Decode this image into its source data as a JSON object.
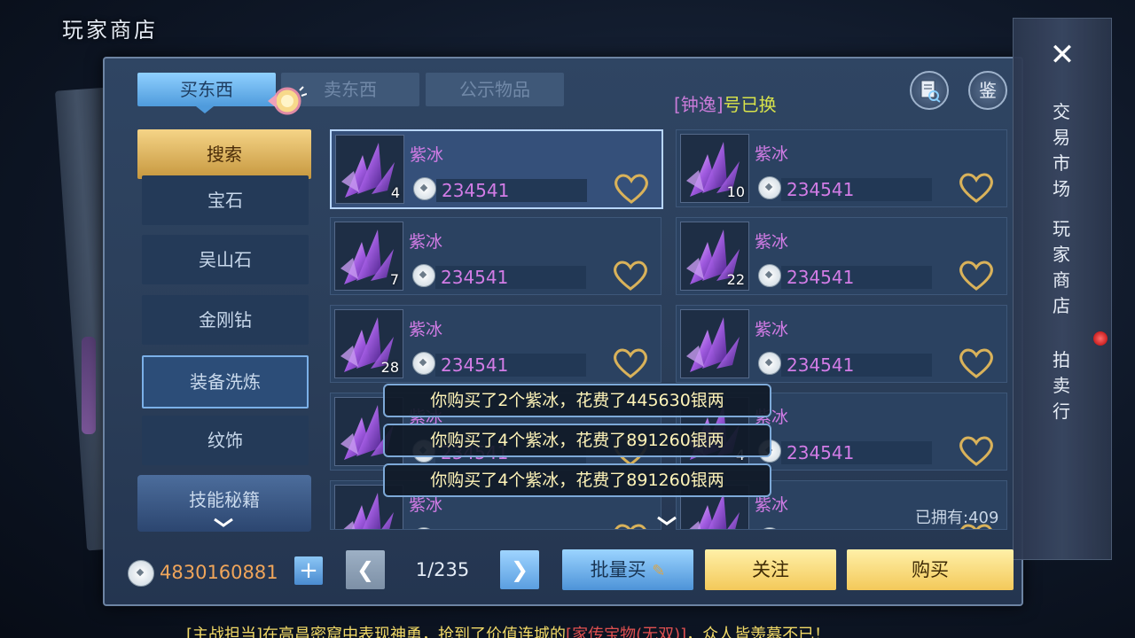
{
  "title": "玩家商店",
  "tabs": [
    {
      "label": "买东西",
      "active": true
    },
    {
      "label": "卖东西",
      "active": false
    },
    {
      "label": "公示物品",
      "active": false
    }
  ],
  "notice": {
    "name": "[钟逸]",
    "text": "号已换"
  },
  "top_buttons": {
    "search_icon": "book-search-icon",
    "appraise_label": "鉴"
  },
  "close_icon": "close-icon",
  "right_nav": {
    "items": [
      "交易市场",
      "玩家商店",
      "拍卖行"
    ]
  },
  "categories": [
    "搜索",
    "宝石",
    "吴山石",
    "金刚钻",
    "装备洗炼",
    "纹饰",
    "技能秘籍"
  ],
  "items": [
    {
      "name": "紫冰",
      "qty": "4",
      "price": "234541"
    },
    {
      "name": "紫冰",
      "qty": "10",
      "price": "234541"
    },
    {
      "name": "紫冰",
      "qty": "7",
      "price": "234541"
    },
    {
      "name": "紫冰",
      "qty": "22",
      "price": "234541"
    },
    {
      "name": "紫冰",
      "qty": "28",
      "price": "234541"
    },
    {
      "name": "紫冰",
      "qty": "",
      "price": "234541"
    },
    {
      "name": "紫冰",
      "qty": "",
      "price": "234541"
    },
    {
      "name": "紫冰",
      "qty": "4",
      "price": "234541"
    },
    {
      "name": "紫冰",
      "qty": "",
      "price": ""
    },
    {
      "name": "紫冰",
      "qty": "",
      "price": ""
    }
  ],
  "owned": "已拥有:409",
  "toasts": [
    "你购买了2个紫冰，花费了445630银两",
    "你购买了4个紫冰，花费了891260银两",
    "你购买了4个紫冰，花费了891260银两"
  ],
  "footer": {
    "money": "4830160881",
    "plus": "+",
    "page": "1/235",
    "batch_buy": "批量买",
    "follow": "关注",
    "buy": "购买"
  },
  "ticker": {
    "part1": "[主战担当]在高昌密窟中表现神勇，抢到了价值连城的",
    "part2": "[家传宝物(无双)]",
    "part3": "，众人皆羡慕不已！"
  },
  "colors": {
    "accent_gold": "#f3c95a",
    "accent_blue": "#4f9bdc",
    "price_purple": "#d27ce6"
  }
}
